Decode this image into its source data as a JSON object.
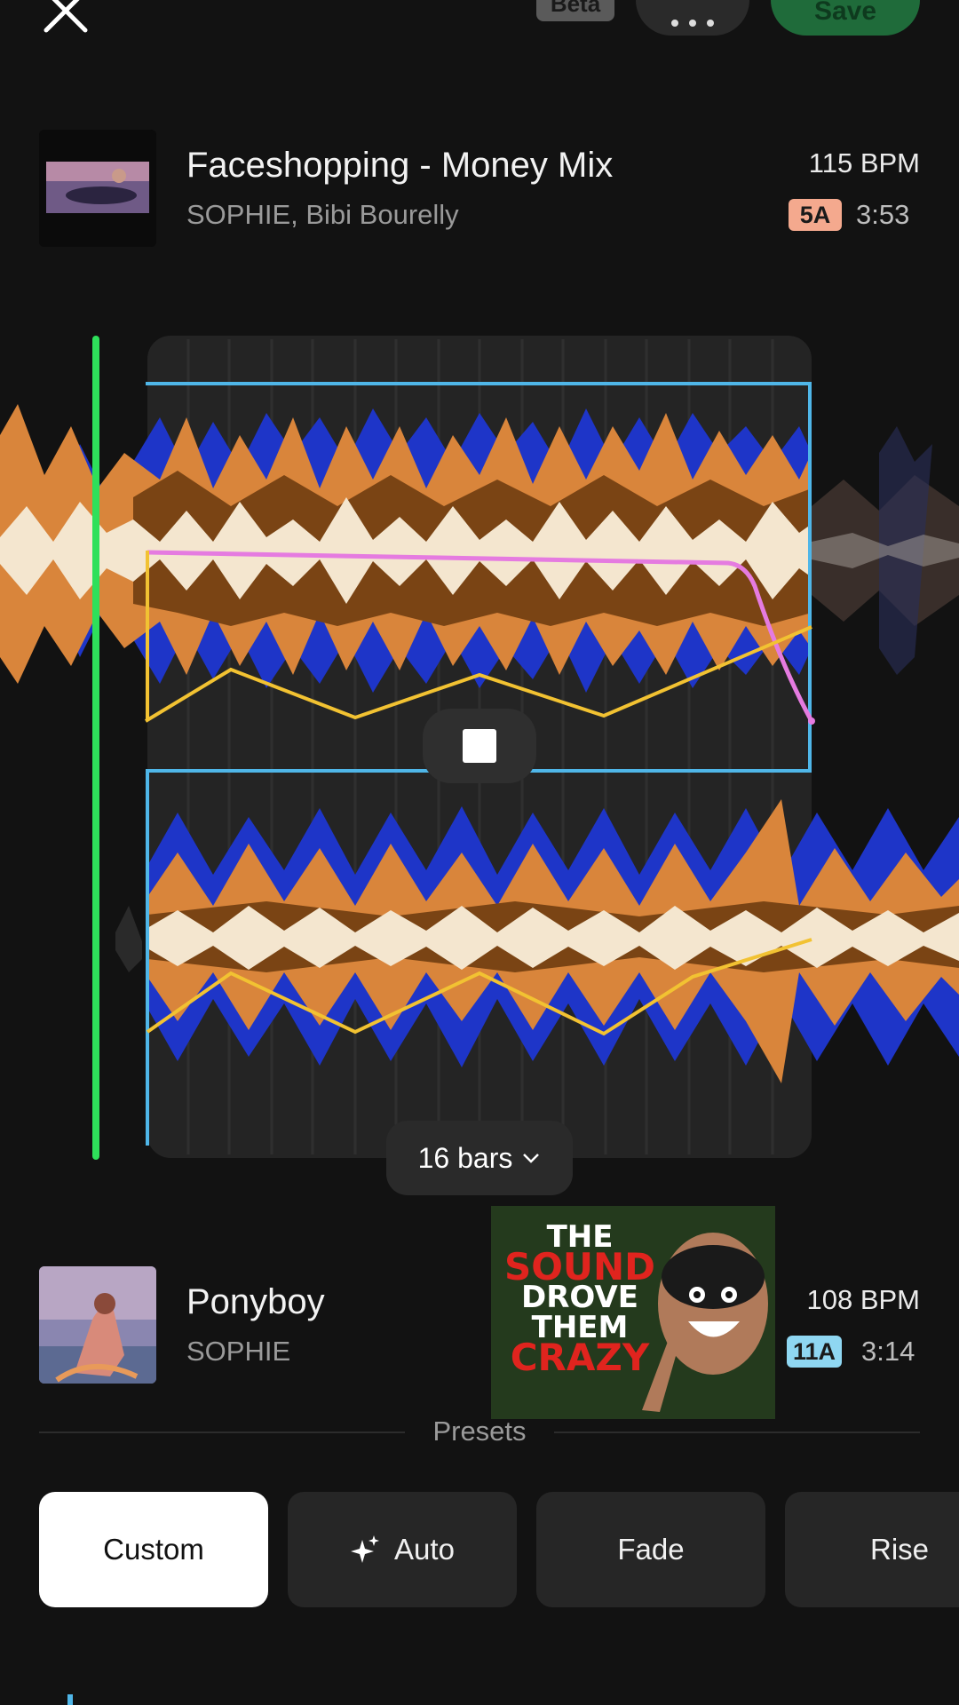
{
  "header": {
    "beta_label": "Beta",
    "save_label": "Save",
    "icons": [
      "close-icon",
      "more-icon"
    ]
  },
  "track_a": {
    "title": "Faceshopping - Money Mix",
    "artist": "SOPHIE, Bibi Bourelly",
    "bpm": "115 BPM",
    "key": "5A",
    "key_color": "#f4a98e",
    "duration": "3:53"
  },
  "transition": {
    "length_label": "16 bars",
    "colors": {
      "playhead": "#2ee05a",
      "selection": "#4fb6e8",
      "volume_curve": "#e57be0",
      "eq_curve": "#f2c232",
      "wave_low": "#1e35c8",
      "wave_mid": "#d9853b",
      "wave_high": "#f4e6cf"
    }
  },
  "track_b": {
    "title": "Ponyboy",
    "artist": "SOPHIE",
    "bpm": "108 BPM",
    "key": "11A",
    "key_color": "#8fd7f2",
    "duration": "3:14"
  },
  "overlay_thumbnail": {
    "lines": [
      "THE",
      "SOUND",
      "DROVE",
      "THEM",
      "CRAZY"
    ]
  },
  "presets": {
    "label": "Presets",
    "items": [
      {
        "label": "Custom",
        "active": true
      },
      {
        "label": "Auto",
        "active": false,
        "icon": "sparkle-icon"
      },
      {
        "label": "Fade",
        "active": false
      },
      {
        "label": "Rise",
        "active": false
      }
    ]
  }
}
